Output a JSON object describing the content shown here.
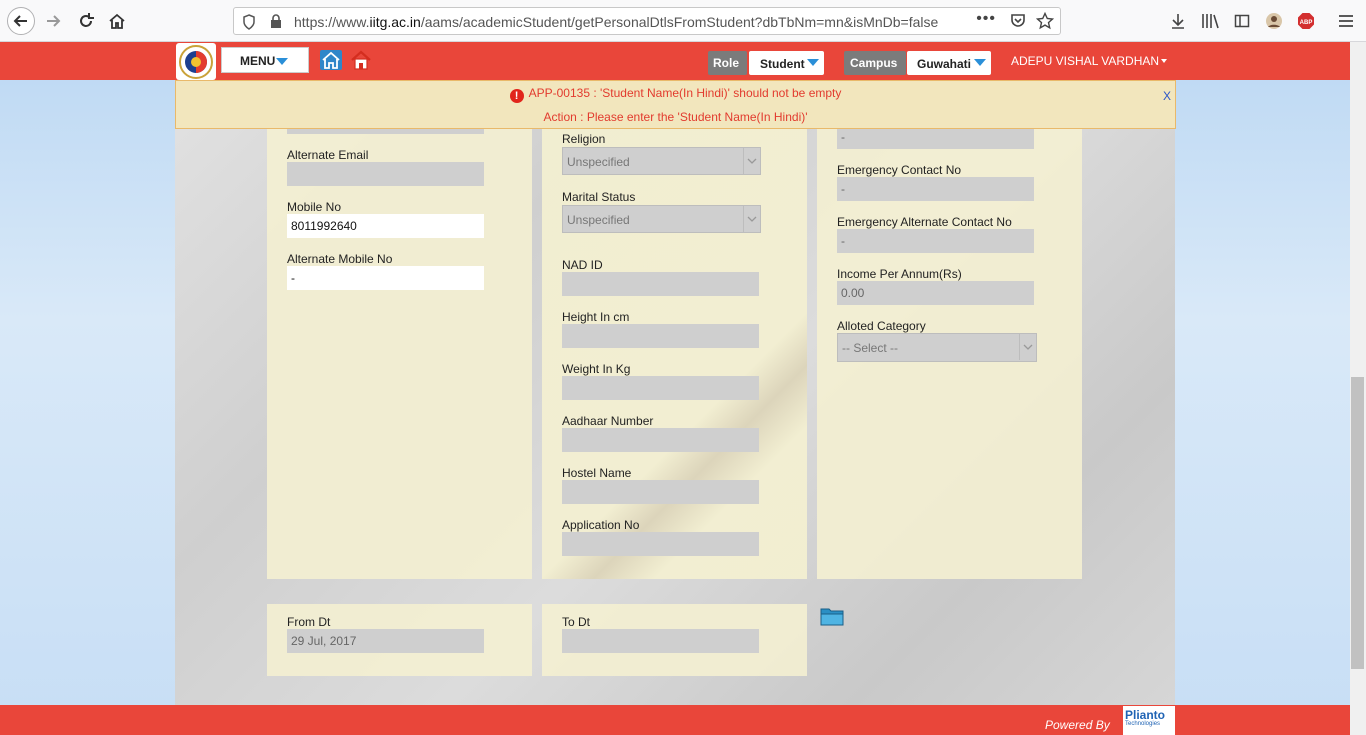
{
  "browser": {
    "url_prefix": "https://www.",
    "url_domain": "iitg.ac.in",
    "url_path": "/aams/academicStudent/getPersonalDtlsFromStudent?dbTbNm=mn&isMnDb=false",
    "more_label": "•••",
    "adblock_label": "ABP"
  },
  "header": {
    "menu_label": "MENU",
    "role_label": "Role",
    "role_value": "Student",
    "campus_label": "Campus",
    "campus_value": "Guwahati",
    "user_name": "ADEPU VISHAL VARDHAN"
  },
  "error": {
    "icon": "!",
    "message": "APP-00135 : 'Student Name(In Hindi)' should not be empty",
    "action": "Action : Please enter the 'Student Name(In Hindi)'",
    "close_label": "X"
  },
  "column1": {
    "alternate_email_label": "Alternate Email",
    "alternate_email_value": "",
    "mobile_no_label": "Mobile No",
    "mobile_no_value": "8011992640",
    "alt_mobile_label": "Alternate Mobile No",
    "alt_mobile_value": "-"
  },
  "column2": {
    "religion_label": "Religion",
    "religion_value": "Unspecified",
    "marital_label": "Marital Status",
    "marital_value": "Unspecified",
    "nad_label": "NAD ID",
    "height_label": "Height In cm",
    "weight_label": "Weight In Kg",
    "aadhaar_label": "Aadhaar Number",
    "hostel_label": "Hostel Name",
    "application_label": "Application No"
  },
  "column3": {
    "top_value": "-",
    "emergency_label": "Emergency Contact No",
    "emergency_value": "-",
    "emergency_alt_label": "Emergency Alternate Contact No",
    "emergency_alt_value": "-",
    "income_label": "Income Per Annum(Rs)",
    "income_value": "0.00",
    "category_label": "Alloted Category",
    "category_value": "-- Select --"
  },
  "dates": {
    "from_label": "From Dt",
    "from_value": "29 Jul, 2017",
    "to_label": "To Dt",
    "to_value": ""
  },
  "footer": {
    "powered_by": "Powered By",
    "brand": "Plianto",
    "brand_sub": "Technologies"
  },
  "colors": {
    "header_red": "#e9463a",
    "error_text": "#e23b2e",
    "panel_bg": "#f4f0d1",
    "field_bg": "#cfcfcf"
  }
}
